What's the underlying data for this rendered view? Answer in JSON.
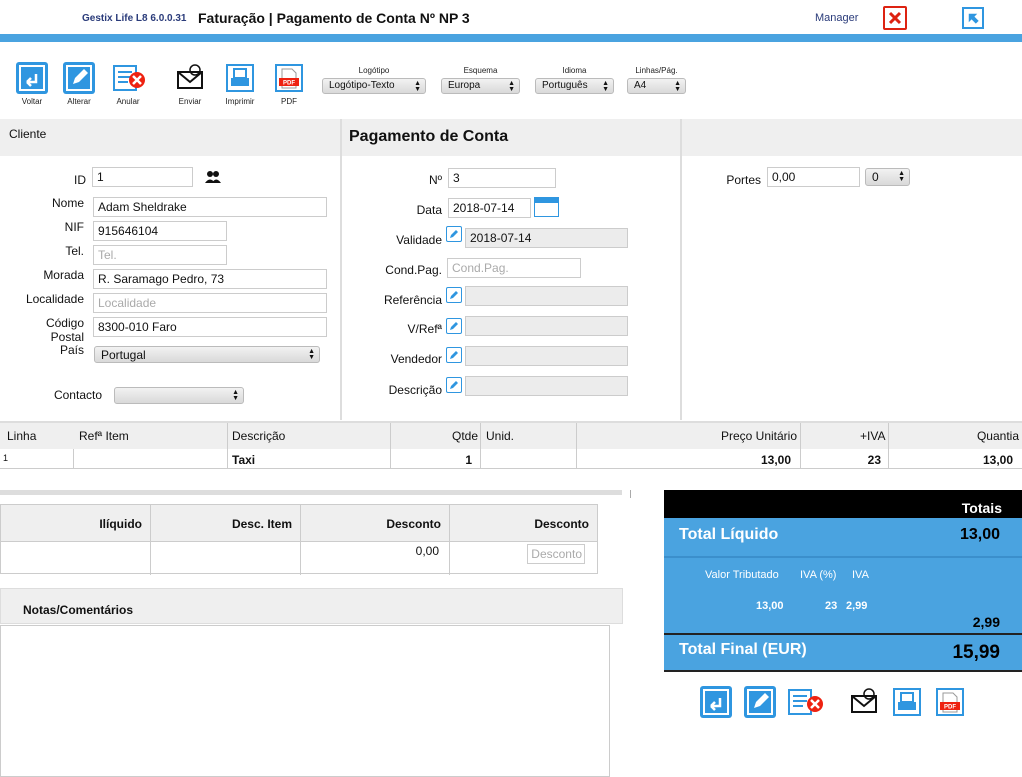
{
  "header": {
    "app_name": "Gestix Life L8 6.0.0.31",
    "title": "Faturação | Pagamento de Conta Nº NP 3",
    "user": "Manager"
  },
  "toolbar": {
    "back": "Voltar",
    "edit": "Alterar",
    "cancel": "Anular",
    "send": "Enviar",
    "print": "Imprimir",
    "pdf": "PDF"
  },
  "selects": {
    "logo": {
      "label": "Logótipo",
      "value": "Logótipo-Texto"
    },
    "scheme": {
      "label": "Esquema",
      "value": "Europa"
    },
    "language": {
      "label": "Idioma",
      "value": "Português"
    },
    "lines": {
      "label": "Linhas/Pág.",
      "value": "A4"
    }
  },
  "client": {
    "heading": "Cliente",
    "id_label": "ID",
    "id_value": "1",
    "name_label": "Nome",
    "name_value": "Adam Sheldrake",
    "nif_label": "NIF",
    "nif_value": "915646104",
    "tel_label": "Tel.",
    "tel_placeholder": "Tel.",
    "address_label": "Morada",
    "address_value": "R. Saramago Pedro, 73",
    "locality_label": "Localidade",
    "locality_placeholder": "Localidade",
    "postal_label_1": "Código",
    "postal_label_2": "Postal",
    "postal_value": "8300-010 Faro",
    "country_label": "País",
    "country_value": "Portugal",
    "contact_label": "Contacto",
    "contact_value": ""
  },
  "document": {
    "heading": "Pagamento de Conta",
    "number_label": "Nº",
    "number_value": "3",
    "date_label": "Data",
    "date_value": "2018-07-14",
    "validity_label": "Validade",
    "validity_value": "2018-07-14",
    "payment_label": "Cond.Pag.",
    "payment_placeholder": "Cond.Pag.",
    "reference_label": "Referência",
    "reference_value": "",
    "yourref_label": "V/Refª",
    "yourref_value": "",
    "seller_label": "Vendedor",
    "seller_value": "",
    "description_label": "Descrição",
    "description_value": ""
  },
  "shipping": {
    "label": "Portes",
    "value": "0,00",
    "vat_value": "0"
  },
  "lines": {
    "headers": {
      "line": "Linha",
      "ref": "Refª Item",
      "desc": "Descrição",
      "qty": "Qtde",
      "unit": "Unid.",
      "price": "Preço Unitário",
      "vat": "+IVA",
      "amount": "Quantia"
    },
    "rows": [
      {
        "line": "1",
        "ref": "",
        "desc": "Taxi",
        "qty": "1",
        "unit": "",
        "price": "13,00",
        "vat": "23",
        "amount": "13,00"
      }
    ]
  },
  "discounts": {
    "h_net": "Ilíquido",
    "h_item_disc": "Desc. Item",
    "h_disc": "Desconto",
    "h_disc2": "Desconto",
    "v_net": "",
    "v_item_disc": "",
    "v_disc": "0,00",
    "disc_placeholder": "Desconto"
  },
  "notes": {
    "heading": "Notas/Comentários"
  },
  "totals": {
    "heading": "Totais",
    "net_label": "Total Líquido",
    "net_value": "13,00",
    "taxed_label": "Valor Tributado",
    "vat_pct_label": "IVA (%)",
    "vat_label": "IVA",
    "taxed_value": "13,00",
    "vat_pct_value": "23",
    "vat_value": "2,99",
    "vat_total": "2,99",
    "final_label": "Total Final (EUR)",
    "final_value": "15,99"
  },
  "colors": {
    "accent": "#4aa3e0",
    "icon_blue": "#2f96e0",
    "danger": "#dd2211"
  }
}
